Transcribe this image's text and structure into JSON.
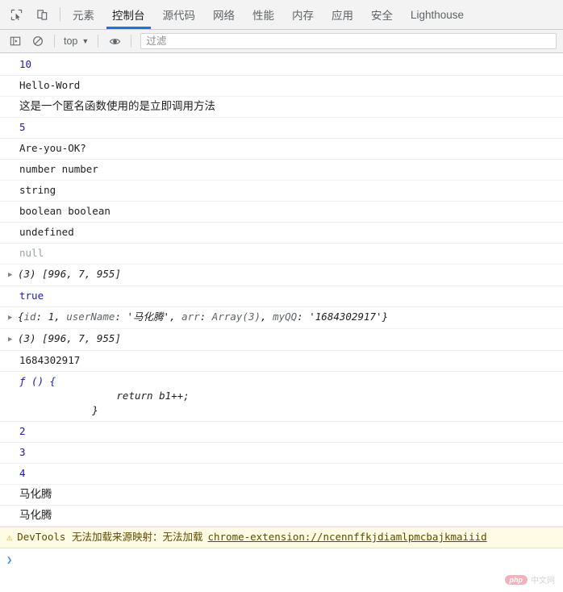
{
  "tabbar": {
    "inspect_icon": "inspect-element-icon",
    "device_icon": "device-toolbar-icon",
    "tabs": [
      {
        "label": "元素",
        "active": false
      },
      {
        "label": "控制台",
        "active": true
      },
      {
        "label": "源代码",
        "active": false
      },
      {
        "label": "网络",
        "active": false
      },
      {
        "label": "性能",
        "active": false
      },
      {
        "label": "内存",
        "active": false
      },
      {
        "label": "应用",
        "active": false
      },
      {
        "label": "安全",
        "active": false
      },
      {
        "label": "Lighthouse",
        "active": false
      }
    ]
  },
  "filterbar": {
    "sidebar_icon": "console-sidebar-icon",
    "clear_icon": "clear-console-icon",
    "context": "top",
    "caret": "▼",
    "eye_icon": "live-expression-eye-icon",
    "filter_placeholder": "过滤",
    "filter_value": ""
  },
  "console": {
    "rows": [
      {
        "kind": "value",
        "text": "10",
        "style": "num"
      },
      {
        "kind": "value",
        "text": "Hello-Word",
        "style": "plain"
      },
      {
        "kind": "cjk",
        "text": "这是一个匿名函数使用的是立即调用方法",
        "style": "plain"
      },
      {
        "kind": "value",
        "text": "5",
        "style": "num"
      },
      {
        "kind": "value",
        "text": "Are-you-OK?",
        "style": "plain"
      },
      {
        "kind": "value",
        "text": "number number",
        "style": "plain"
      },
      {
        "kind": "value",
        "text": "string",
        "style": "plain"
      },
      {
        "kind": "value",
        "text": "boolean boolean",
        "style": "plain"
      },
      {
        "kind": "value",
        "text": "undefined",
        "style": "plain"
      },
      {
        "kind": "value",
        "text": "null",
        "style": "nul"
      },
      {
        "kind": "array",
        "triangle": "▶",
        "count": "(3)",
        "items": [
          "996",
          "7",
          "955"
        ]
      },
      {
        "kind": "value",
        "text": "true",
        "style": "boolv"
      },
      {
        "kind": "object",
        "triangle": "▶",
        "props": [
          {
            "key": "id",
            "value": "1",
            "vstyle": "num"
          },
          {
            "key": "userName",
            "value": "'马化腾'",
            "vstyle": "str"
          },
          {
            "key": "arr",
            "value": "Array(3)",
            "vstyle": "obj"
          },
          {
            "key": "myQQ",
            "value": "'1684302917'",
            "vstyle": "str"
          }
        ]
      },
      {
        "kind": "array",
        "triangle": "▶",
        "count": "(3)",
        "items": [
          "996",
          "7",
          "955"
        ]
      },
      {
        "kind": "value",
        "text": "1684302917",
        "style": "plain"
      },
      {
        "kind": "function",
        "head": "ƒ () {",
        "body": "                return b1++;\n            }"
      },
      {
        "kind": "value",
        "text": "2",
        "style": "num"
      },
      {
        "kind": "value",
        "text": "3",
        "style": "num"
      },
      {
        "kind": "value",
        "text": "4",
        "style": "num"
      },
      {
        "kind": "cjk",
        "text": "马化腾",
        "style": "plain"
      },
      {
        "kind": "cjk",
        "text": "马化腾",
        "style": "plain"
      }
    ],
    "warning": {
      "icon": "warning-triangle-icon",
      "message": "DevTools 无法加载来源映射：无法加载",
      "link": "chrome-extension://ncennffkjdiamlpmcbajkmaiiid"
    },
    "prompt": {
      "chevron": "❯",
      "value": ""
    }
  },
  "watermark": {
    "badge": "php",
    "text": "中文网"
  }
}
